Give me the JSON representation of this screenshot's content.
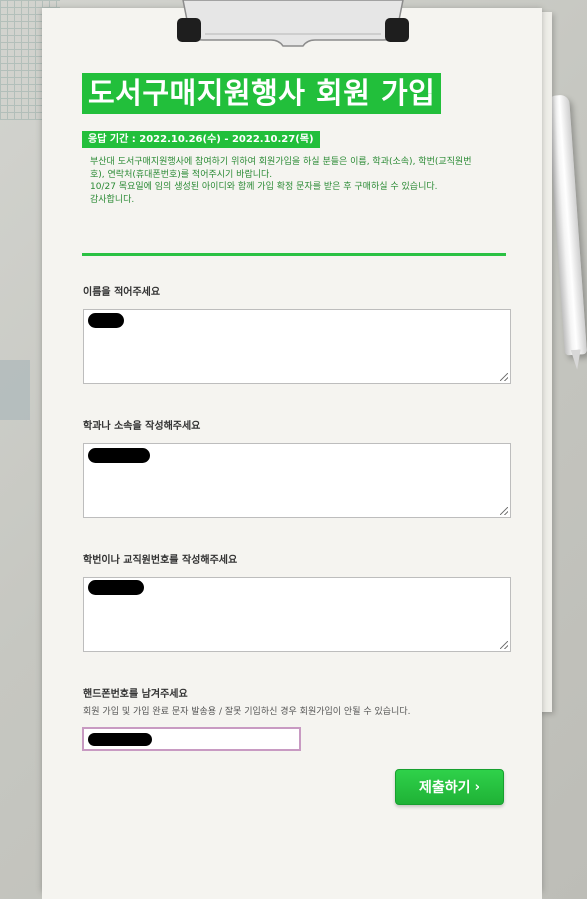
{
  "form": {
    "title": "도서구매지원행사 회원 가입",
    "period": "응답 기간 : 2022.10.26(수) - 2022.10.27(목)",
    "intro_lines": [
      "부산대 도서구매지원행사에 참여하기 위하여 회원가입을 하실 분들은 이름, 학과(소속), 학번(교직원번",
      "호), 연락처(휴대폰번호)를 적어주시기 바랍니다.",
      "10/27 목요일에 임의 생성된 아이디와 함께 가입 확정 문자를 받은 후 구매하실 수 있습니다.",
      "감사합니다."
    ]
  },
  "questions": {
    "name": {
      "label": "이름을 적어주세요"
    },
    "dept": {
      "label": "학과나 소속을 작성해주세요"
    },
    "student_id": {
      "label": "학번이나 교직원번호를 작성해주세요"
    },
    "phone": {
      "label": "핸드폰번호를 남겨주세요",
      "help": "회원 가입 및 가입 완료 문자 발송용 / 잘못 기입하신 경우 회원가입이 안될 수 있습니다."
    }
  },
  "submit": {
    "label": "제출하기",
    "chevron": "›"
  },
  "colors": {
    "accent": "#22bf3b",
    "phone_border": "#c89ac2"
  },
  "icons": {
    "clip": "clipboard-clip-icon",
    "pen": "pen-icon",
    "resize": "resize-grip-icon"
  }
}
